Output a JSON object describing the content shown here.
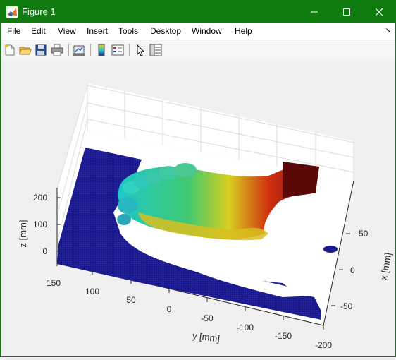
{
  "window": {
    "title": "Figure 1",
    "controls": [
      "minimize-icon",
      "maximize-icon",
      "close-icon"
    ],
    "accent_color": "#107c10"
  },
  "menu": {
    "items": [
      "File",
      "Edit",
      "View",
      "Insert",
      "Tools",
      "Desktop",
      "Window",
      "Help"
    ]
  },
  "toolbar": {
    "buttons": [
      "new-figure-icon",
      "open-file-icon",
      "save-icon",
      "print-icon",
      "link-plot-icon",
      "colorbar-icon",
      "legend-icon",
      "edit-plot-arrow-icon",
      "property-inspector-icon"
    ]
  },
  "plot": {
    "z_axis": {
      "label": "z [mm]",
      "ticks": [
        "200",
        "100",
        "0"
      ]
    },
    "y_axis": {
      "label": "y [mm]",
      "ticks": [
        "150",
        "100",
        "50",
        "0",
        "-50",
        "-100",
        "-150",
        "-200"
      ]
    },
    "x_axis": {
      "label": "x [mm]",
      "ticks": [
        "50",
        "0",
        "-50"
      ]
    },
    "colormap": [
      "#1a1a8c",
      "#1ec8c8",
      "#d8d020",
      "#d03010",
      "#6a0a0a"
    ]
  }
}
